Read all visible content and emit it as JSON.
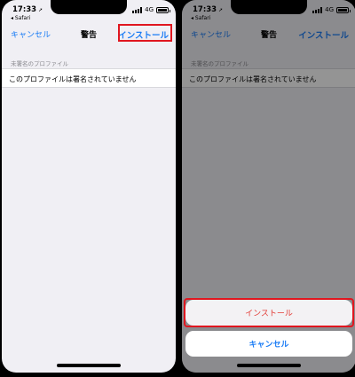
{
  "status": {
    "time": "17:33",
    "location_arrow": "➚",
    "back_app": "◂ Safari",
    "network": "4G"
  },
  "navbar": {
    "cancel_label": "キャンセル",
    "title": "警告",
    "install_label": "インストール"
  },
  "profile": {
    "section_header": "未署名のプロファイル",
    "message": "このプロファイルは署名されていません"
  },
  "action_sheet": {
    "install_label": "インストール",
    "cancel_label": "キャンセル"
  },
  "colors": {
    "accent_blue": "#1a7cf5",
    "destructive_red": "#e23c36",
    "highlight_red": "#e0161f",
    "background": "#f0eff4"
  },
  "icons": [
    "location-arrow-icon",
    "signal-icon",
    "battery-icon"
  ]
}
